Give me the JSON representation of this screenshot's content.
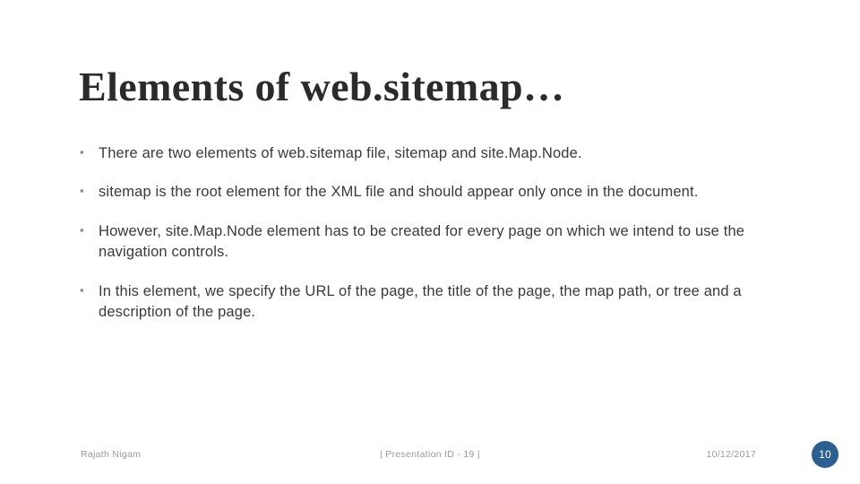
{
  "slide": {
    "title": "Elements of web.sitemap…",
    "bullets": [
      "There are two elements of web.sitemap file, sitemap and site.Map.Node.",
      "sitemap is the root element for the XML file and should appear only once in the document.",
      "However, site.Map.Node element has to be created for every page on which we intend to use the navigation controls.",
      "In this element, we specify the URL of the page, the title of the page, the map path, or tree and a description of the page."
    ],
    "footer": {
      "author": "Rajath Nigam",
      "center": "| Presentation ID - 19 |",
      "date": "10/12/2017",
      "slide_number": "10"
    },
    "colors": {
      "title": "#2b2b2b",
      "body": "#3a3a3a",
      "footer": "#9a9a9a",
      "badge": "#2a5f8f"
    }
  }
}
